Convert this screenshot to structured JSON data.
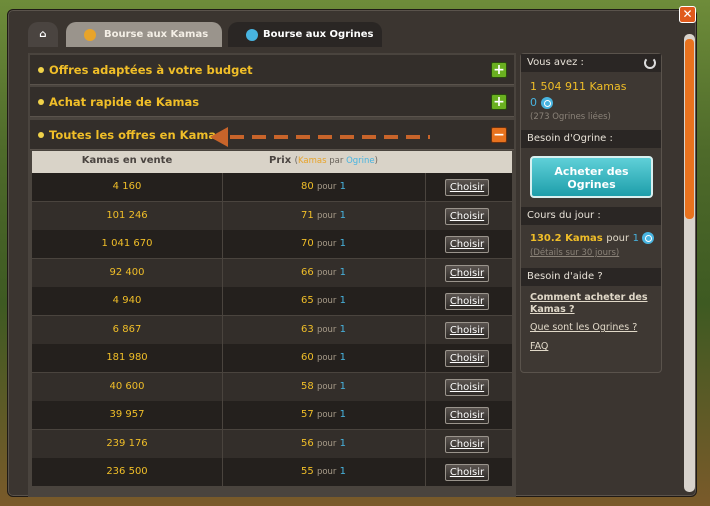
{
  "tabs": {
    "kamas": "Bourse aux Kamas",
    "ogrines": "Bourse aux Ogrines"
  },
  "accordions": {
    "budget": "Offres adaptées à votre budget",
    "quick": "Achat rapide de Kamas",
    "all": "Toutes les offres en Kamas"
  },
  "table": {
    "col1": "Kamas en vente",
    "col2_prefix": "Prix",
    "col2_kamas": "Kamas",
    "col2_par": "par",
    "col2_ogrine": "Ogrine",
    "button": "Choisir",
    "pour": "pour",
    "unit": "1",
    "rows": [
      {
        "kamas": "4 160",
        "price": "80"
      },
      {
        "kamas": "101 246",
        "price": "71"
      },
      {
        "kamas": "1 041 670",
        "price": "70"
      },
      {
        "kamas": "92 400",
        "price": "66"
      },
      {
        "kamas": "4 940",
        "price": "65"
      },
      {
        "kamas": "6 867",
        "price": "63"
      },
      {
        "kamas": "181 980",
        "price": "60"
      },
      {
        "kamas": "40 600",
        "price": "58"
      },
      {
        "kamas": "39 957",
        "price": "57"
      },
      {
        "kamas": "239 176",
        "price": "56"
      },
      {
        "kamas": "236 500",
        "price": "55"
      }
    ]
  },
  "sidebar": {
    "vous_avez": "Vous avez :",
    "kamas": "1 504 911 Kamas",
    "ogrines": "0",
    "ogrines_liees": "(273 Ogrines liées)",
    "besoin_ogrine": "Besoin d'Ogrine :",
    "acheter": "Acheter des Ogrines",
    "cours": "Cours du jour :",
    "cours_value": "130.2 Kamas",
    "cours_pour": "pour",
    "cours_unit": "1",
    "details": "(Détails sur 30 jours)",
    "aide": "Besoin d'aide ?",
    "help1": "Comment acheter des Kamas ?",
    "help2": "Que sont les Ogrines ?",
    "help3": "FAQ"
  },
  "colors": {
    "gold": "#f0be28",
    "ogrine": "#48b4e0",
    "accent": "#e8721e"
  }
}
